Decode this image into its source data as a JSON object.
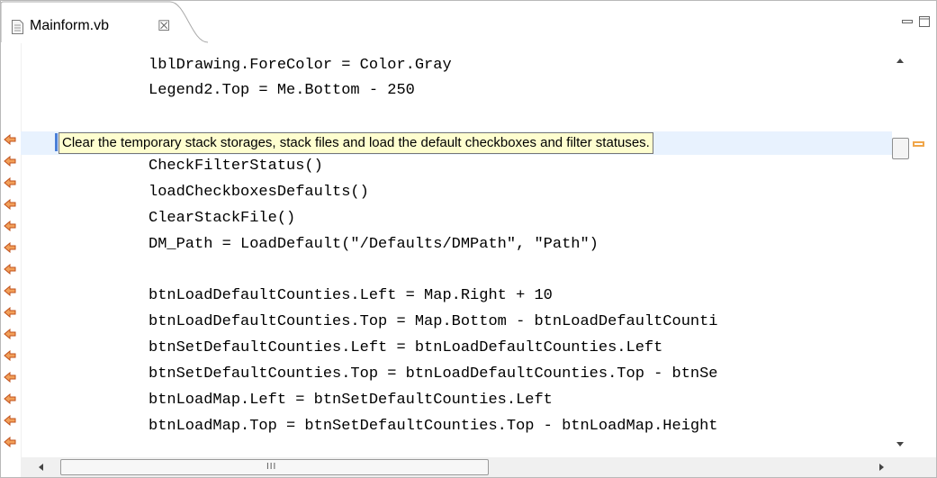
{
  "tab": {
    "title": "Mainform.vb",
    "close_glyph": "☒",
    "icon": "file-icon"
  },
  "window_controls": {
    "minimize_icon": "minimize-icon",
    "maximize_icon": "maximize-icon"
  },
  "editor": {
    "lines": [
      "lblDrawing.ForeColor = Color.Gray",
      "Legend2.Top = Me.Bottom - 250",
      "",
      "",
      "CheckFilterStatus()",
      "loadCheckboxesDefaults()",
      "ClearStackFile()",
      "DM_Path = LoadDefault(\"/Defaults/DMPath\", \"Path\")",
      "",
      "btnLoadDefaultCounties.Left = Map.Right + 10",
      "btnLoadDefaultCounties.Top = Map.Bottom - btnLoadDefaultCounti",
      "btnSetDefaultCounties.Left = btnLoadDefaultCounties.Left",
      "btnSetDefaultCounties.Top = btnLoadDefaultCounties.Top - btnSe",
      "btnLoadMap.Left = btnSetDefaultCounties.Left",
      "btnLoadMap.Top = btnSetDefaultCounties.Top - btnLoadMap.Height"
    ],
    "tooltip": "Clear the temporary stack storages, stack files and load the default checkboxes and filter statuses.",
    "marker_icon": "arrow-left-icon",
    "marker_color": "#d9531e",
    "overview_mark_color": "#f0a64a",
    "current_line_color": "#e8f2fe",
    "hscroll_grip": "III"
  }
}
